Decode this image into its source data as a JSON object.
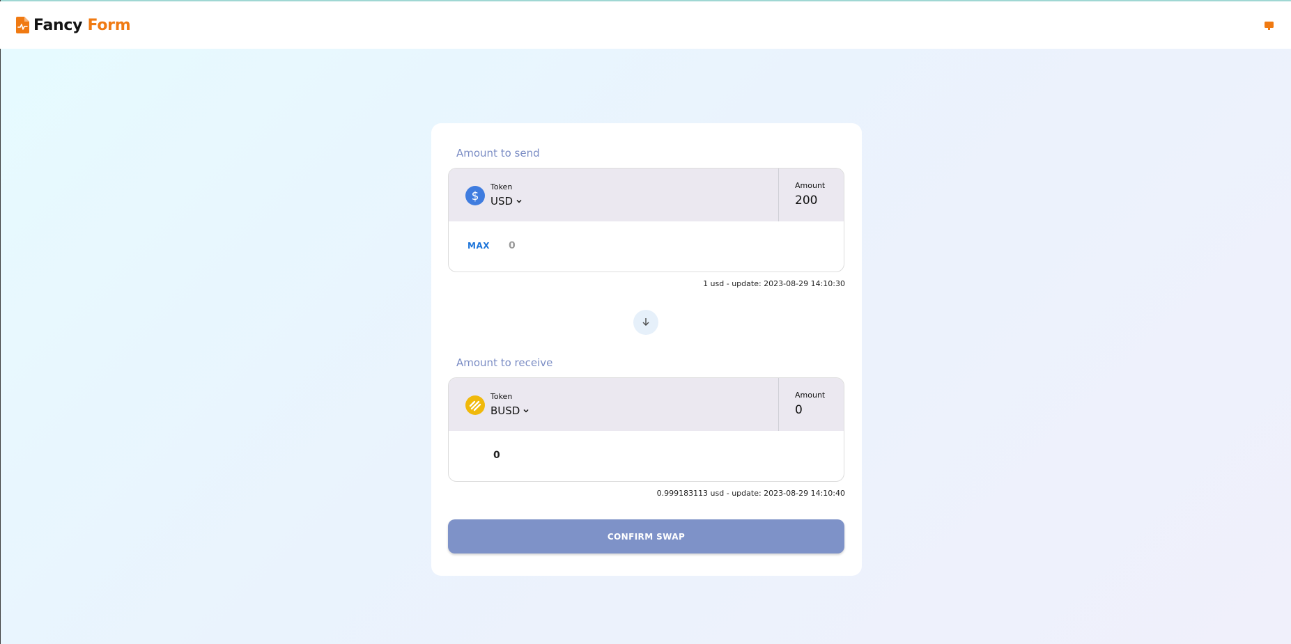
{
  "header": {
    "logo_word1": "Fancy",
    "logo_word2": "Form",
    "menu_icon": "menu-icon",
    "accent_color": "#f07a12"
  },
  "send": {
    "section_label": "Amount to send",
    "token_label": "Token",
    "token_value": "USD",
    "token_icon": "dollar-coin-icon",
    "amount_label": "Amount",
    "amount_value": "200",
    "max_label": "MAX",
    "max_value": "0",
    "rate_text": "1 usd - update: 2023-08-29 14:10:30"
  },
  "receive": {
    "section_label": "Amount to receive",
    "token_label": "Token",
    "token_value": "BUSD",
    "token_icon": "busd-coin-icon",
    "amount_label": "Amount",
    "amount_value": "0",
    "bottom_value": "0",
    "rate_text": "0.999183113 usd - update: 2023-08-29 14:10:40"
  },
  "swap_direction_icon": "arrow-down-icon",
  "confirm_label": "CONFIRM SWAP",
  "colors": {
    "primary_button": "#7e92c8",
    "max_link": "#1a73d9",
    "section_label": "#7a8cc4"
  }
}
